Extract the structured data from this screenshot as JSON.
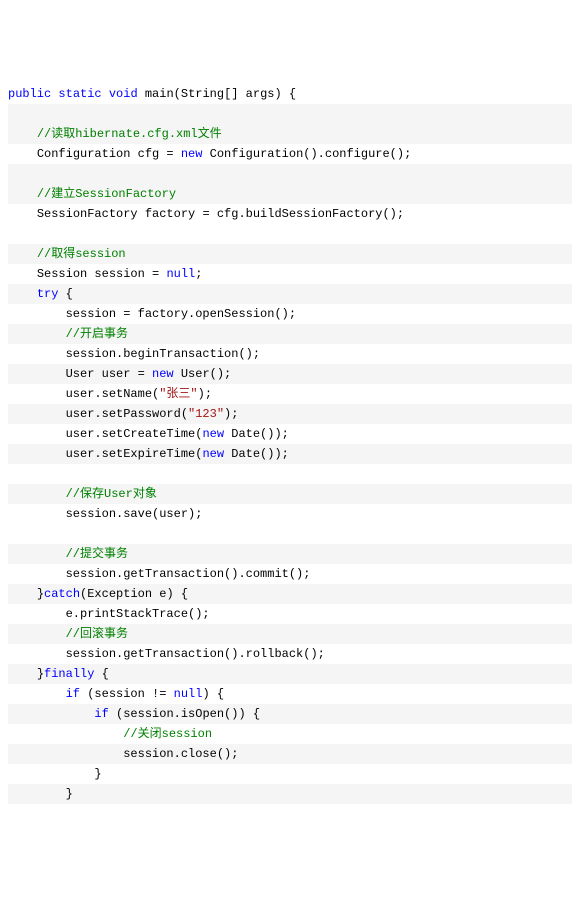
{
  "code_lines": [
    {
      "stripe": false,
      "indent": 0,
      "segments": [
        {
          "text": "public",
          "cls": "kw"
        },
        {
          "text": " "
        },
        {
          "text": "static",
          "cls": "kw"
        },
        {
          "text": " "
        },
        {
          "text": "void",
          "cls": "kw"
        },
        {
          "text": " main(String[] args) {"
        }
      ]
    },
    {
      "stripe": true,
      "indent": 0,
      "segments": []
    },
    {
      "stripe": true,
      "indent": 2,
      "segments": [
        {
          "text": "//读取hibernate.cfg.xml文件",
          "cls": "cm"
        }
      ]
    },
    {
      "stripe": false,
      "indent": 2,
      "segments": [
        {
          "text": "Configuration cfg = "
        },
        {
          "text": "new",
          "cls": "kw"
        },
        {
          "text": " Configuration().configure();"
        }
      ]
    },
    {
      "stripe": true,
      "indent": 0,
      "segments": []
    },
    {
      "stripe": true,
      "indent": 2,
      "segments": [
        {
          "text": "//建立SessionFactory",
          "cls": "cm"
        }
      ]
    },
    {
      "stripe": false,
      "indent": 2,
      "segments": [
        {
          "text": "SessionFactory factory = cfg.buildSessionFactory();"
        }
      ]
    },
    {
      "stripe": false,
      "indent": 0,
      "segments": []
    },
    {
      "stripe": true,
      "indent": 2,
      "segments": [
        {
          "text": "//取得session",
          "cls": "cm"
        }
      ]
    },
    {
      "stripe": false,
      "indent": 2,
      "segments": [
        {
          "text": "Session session = "
        },
        {
          "text": "null",
          "cls": "kw"
        },
        {
          "text": ";"
        }
      ]
    },
    {
      "stripe": true,
      "indent": 2,
      "segments": [
        {
          "text": "try",
          "cls": "kw"
        },
        {
          "text": " {"
        }
      ]
    },
    {
      "stripe": false,
      "indent": 3,
      "segments": [
        {
          "text": "session = factory.openSession();"
        }
      ]
    },
    {
      "stripe": true,
      "indent": 3,
      "segments": [
        {
          "text": "//开启事务",
          "cls": "cm"
        }
      ]
    },
    {
      "stripe": false,
      "indent": 3,
      "segments": [
        {
          "text": "session.beginTransaction();"
        }
      ]
    },
    {
      "stripe": true,
      "indent": 3,
      "segments": [
        {
          "text": "User user = "
        },
        {
          "text": "new",
          "cls": "kw"
        },
        {
          "text": " User();"
        }
      ]
    },
    {
      "stripe": false,
      "indent": 3,
      "segments": [
        {
          "text": "user.setName("
        },
        {
          "text": "\"张三\"",
          "cls": "st"
        },
        {
          "text": ");"
        }
      ]
    },
    {
      "stripe": true,
      "indent": 3,
      "segments": [
        {
          "text": "user.setPassword("
        },
        {
          "text": "\"123\"",
          "cls": "st"
        },
        {
          "text": ");"
        }
      ]
    },
    {
      "stripe": false,
      "indent": 3,
      "segments": [
        {
          "text": "user.setCreateTime("
        },
        {
          "text": "new",
          "cls": "kw"
        },
        {
          "text": " Date());"
        }
      ]
    },
    {
      "stripe": true,
      "indent": 3,
      "segments": [
        {
          "text": "user.setExpireTime("
        },
        {
          "text": "new",
          "cls": "kw"
        },
        {
          "text": " Date());"
        }
      ]
    },
    {
      "stripe": false,
      "indent": 0,
      "segments": []
    },
    {
      "stripe": true,
      "indent": 3,
      "segments": [
        {
          "text": "//保存User对象",
          "cls": "cm"
        }
      ]
    },
    {
      "stripe": false,
      "indent": 3,
      "segments": [
        {
          "text": "session.save(user);"
        }
      ]
    },
    {
      "stripe": false,
      "indent": 0,
      "segments": []
    },
    {
      "stripe": true,
      "indent": 3,
      "segments": [
        {
          "text": "//提交事务",
          "cls": "cm"
        }
      ]
    },
    {
      "stripe": false,
      "indent": 3,
      "segments": [
        {
          "text": "session.getTransaction().commit();"
        }
      ]
    },
    {
      "stripe": true,
      "indent": 2,
      "segments": [
        {
          "text": "}"
        },
        {
          "text": "catch",
          "cls": "kw"
        },
        {
          "text": "(Exception e) {"
        }
      ]
    },
    {
      "stripe": false,
      "indent": 3,
      "segments": [
        {
          "text": "e.printStackTrace();"
        }
      ]
    },
    {
      "stripe": true,
      "indent": 3,
      "segments": [
        {
          "text": "//回滚事务",
          "cls": "cm"
        }
      ]
    },
    {
      "stripe": false,
      "indent": 3,
      "segments": [
        {
          "text": "session.getTransaction().rollback();"
        }
      ]
    },
    {
      "stripe": true,
      "indent": 2,
      "segments": [
        {
          "text": "}"
        },
        {
          "text": "finally",
          "cls": "kw"
        },
        {
          "text": " {"
        }
      ]
    },
    {
      "stripe": false,
      "indent": 3,
      "segments": [
        {
          "text": "if",
          "cls": "kw"
        },
        {
          "text": " (session != "
        },
        {
          "text": "null",
          "cls": "kw"
        },
        {
          "text": ") {"
        }
      ]
    },
    {
      "stripe": true,
      "indent": 4,
      "segments": [
        {
          "text": "if",
          "cls": "kw"
        },
        {
          "text": " (session.isOpen()) {"
        }
      ]
    },
    {
      "stripe": false,
      "indent": 5,
      "segments": [
        {
          "text": "//关闭session",
          "cls": "cm"
        }
      ]
    },
    {
      "stripe": true,
      "indent": 5,
      "segments": [
        {
          "text": "session.close();"
        }
      ]
    },
    {
      "stripe": false,
      "indent": 4,
      "segments": [
        {
          "text": "}"
        }
      ]
    },
    {
      "stripe": true,
      "indent": 3,
      "segments": [
        {
          "text": "}"
        }
      ]
    }
  ]
}
